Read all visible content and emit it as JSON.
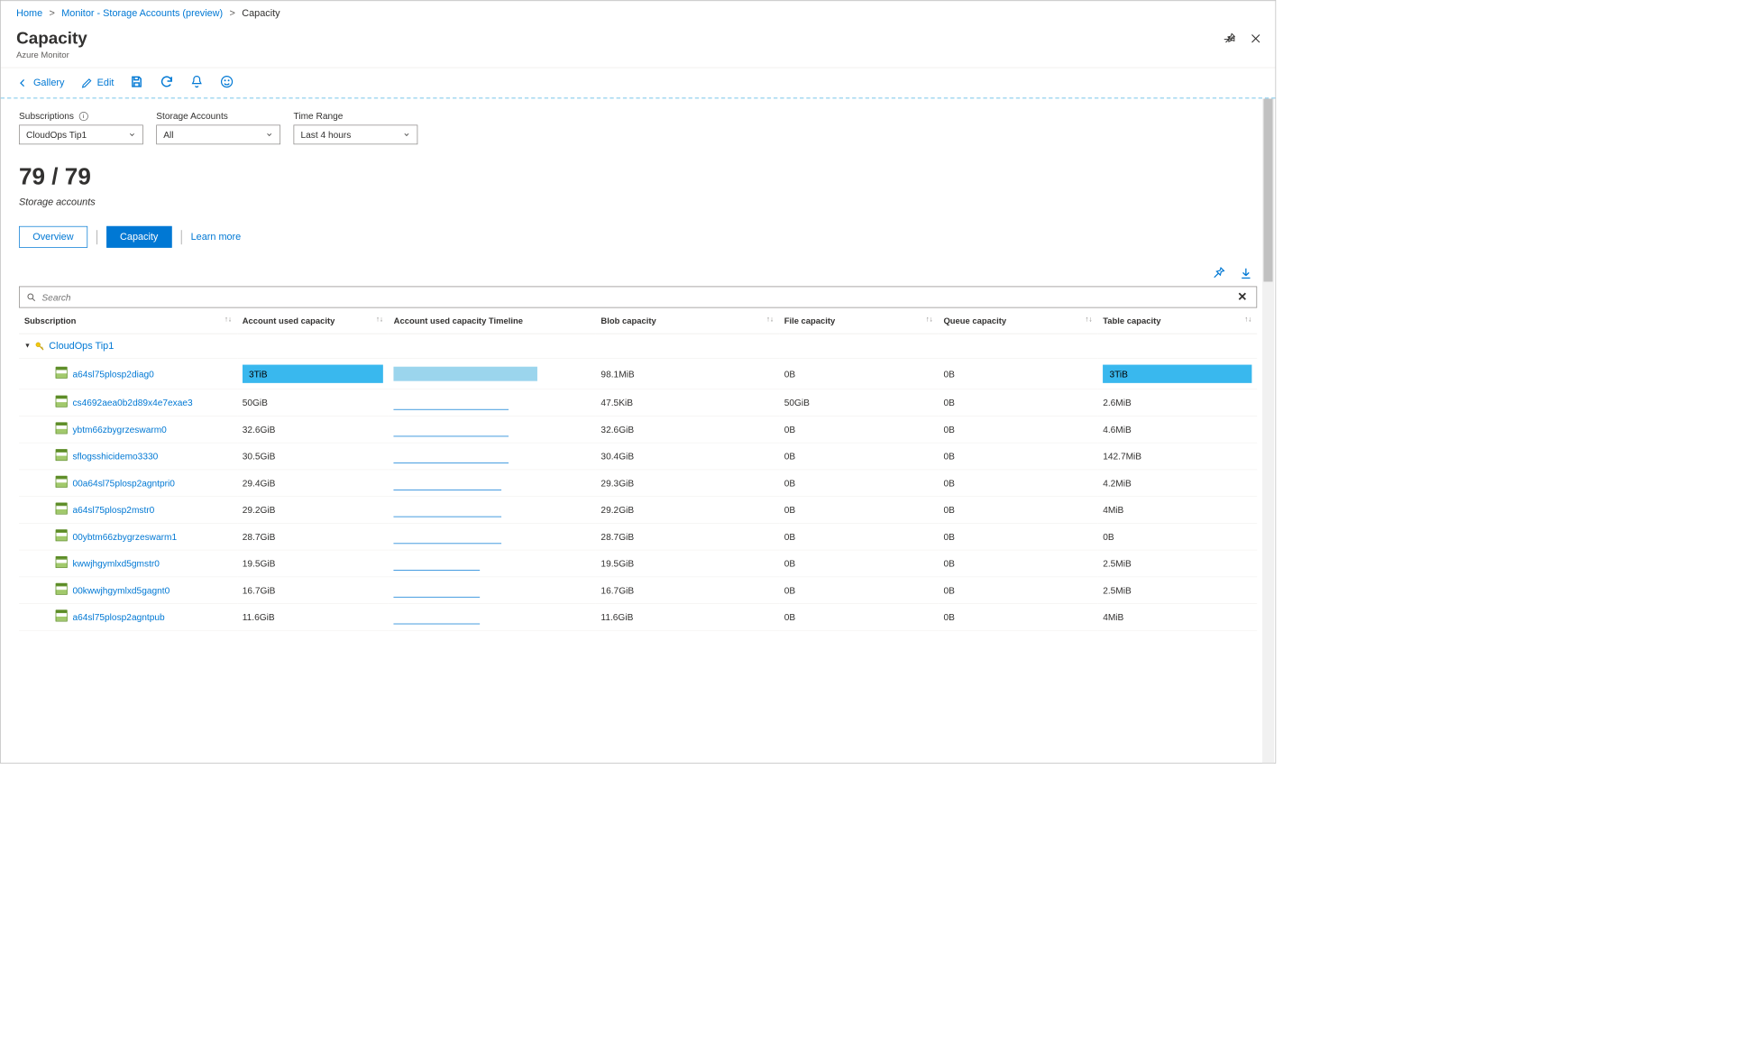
{
  "breadcrumb": {
    "home": "Home",
    "monitor": "Monitor - Storage Accounts (preview)",
    "current": "Capacity"
  },
  "header": {
    "title": "Capacity",
    "subtitle": "Azure Monitor"
  },
  "toolbar": {
    "gallery": "Gallery",
    "edit": "Edit"
  },
  "filters": {
    "subscriptions": {
      "label": "Subscriptions",
      "value": "CloudOps Tip1"
    },
    "accounts": {
      "label": "Storage Accounts",
      "value": "All"
    },
    "time": {
      "label": "Time Range",
      "value": "Last 4 hours"
    }
  },
  "count": {
    "value": "79 / 79",
    "label": "Storage accounts"
  },
  "tabs": {
    "overview": "Overview",
    "capacity": "Capacity",
    "learn": "Learn more"
  },
  "search": {
    "placeholder": "Search"
  },
  "table": {
    "headers": {
      "sub": "Subscription",
      "cap": "Account used capacity",
      "tl": "Account used capacity Timeline",
      "blob": "Blob capacity",
      "file": "File capacity",
      "queue": "Queue capacity",
      "table": "Table capacity"
    },
    "group": "CloudOps Tip1",
    "rows": [
      {
        "name": "a64sl75plosp2diag0",
        "cap": "3TiB",
        "blob": "98.1MiB",
        "file": "0B",
        "queue": "0B",
        "table": "3TiB",
        "highlight": true
      },
      {
        "name": "cs4692aea0b2d89x4e7exae3",
        "cap": "50GiB",
        "blob": "47.5KiB",
        "file": "50GiB",
        "queue": "0B",
        "table": "2.6MiB"
      },
      {
        "name": "ybtm66zbygrzeswarm0",
        "cap": "32.6GiB",
        "blob": "32.6GiB",
        "file": "0B",
        "queue": "0B",
        "table": "4.6MiB"
      },
      {
        "name": "sflogsshicidemo3330",
        "cap": "30.5GiB",
        "blob": "30.4GiB",
        "file": "0B",
        "queue": "0B",
        "table": "142.7MiB"
      },
      {
        "name": "00a64sl75plosp2agntpri0",
        "cap": "29.4GiB",
        "blob": "29.3GiB",
        "file": "0B",
        "queue": "0B",
        "table": "4.2MiB"
      },
      {
        "name": "a64sl75plosp2mstr0",
        "cap": "29.2GiB",
        "blob": "29.2GiB",
        "file": "0B",
        "queue": "0B",
        "table": "4MiB"
      },
      {
        "name": "00ybtm66zbygrzeswarm1",
        "cap": "28.7GiB",
        "blob": "28.7GiB",
        "file": "0B",
        "queue": "0B",
        "table": "0B"
      },
      {
        "name": "kwwjhgymlxd5gmstr0",
        "cap": "19.5GiB",
        "blob": "19.5GiB",
        "file": "0B",
        "queue": "0B",
        "table": "2.5MiB"
      },
      {
        "name": "00kwwjhgymlxd5gagnt0",
        "cap": "16.7GiB",
        "blob": "16.7GiB",
        "file": "0B",
        "queue": "0B",
        "table": "2.5MiB"
      },
      {
        "name": "a64sl75plosp2agntpub",
        "cap": "11.6GiB",
        "blob": "11.6GiB",
        "file": "0B",
        "queue": "0B",
        "table": "4MiB"
      }
    ]
  }
}
